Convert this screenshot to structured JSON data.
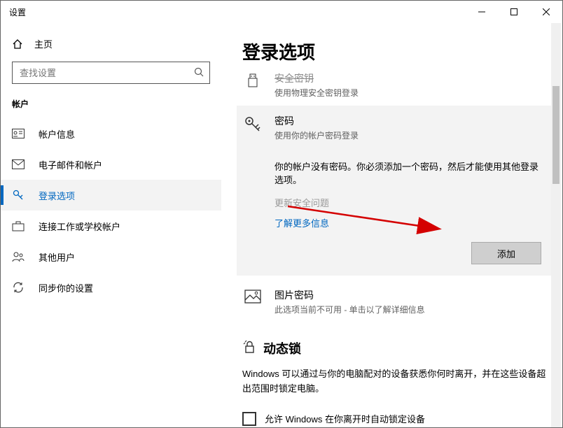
{
  "window": {
    "title": "设置"
  },
  "sidebar": {
    "home": "主页",
    "search_placeholder": "查找设置",
    "group": "帐户",
    "items": [
      {
        "label": "帐户信息"
      },
      {
        "label": "电子邮件和帐户"
      },
      {
        "label": "登录选项"
      },
      {
        "label": "连接工作或学校帐户"
      },
      {
        "label": "其他用户"
      },
      {
        "label": "同步你的设置"
      }
    ]
  },
  "main": {
    "title": "登录选项",
    "security_key": {
      "head": "安全密钥",
      "sub": "使用物理安全密钥登录"
    },
    "password": {
      "head": "密码",
      "sub": "使用你的帐户密码登录",
      "body": "你的帐户没有密码。你必须添加一个密码，然后才能使用其他登录选项。",
      "update_question": "更新安全问题",
      "learn_more": "了解更多信息",
      "add_btn": "添加"
    },
    "picture_pw": {
      "head": "图片密码",
      "sub": "此选项当前不可用 - 单击以了解详细信息"
    },
    "dynamic_lock": {
      "head": "动态锁",
      "body": "Windows 可以通过与你的电脑配对的设备获悉你何时离开，并在这些设备超出范围时锁定电脑。",
      "checkbox_label": "允许 Windows 在你离开时自动锁定设备"
    }
  }
}
